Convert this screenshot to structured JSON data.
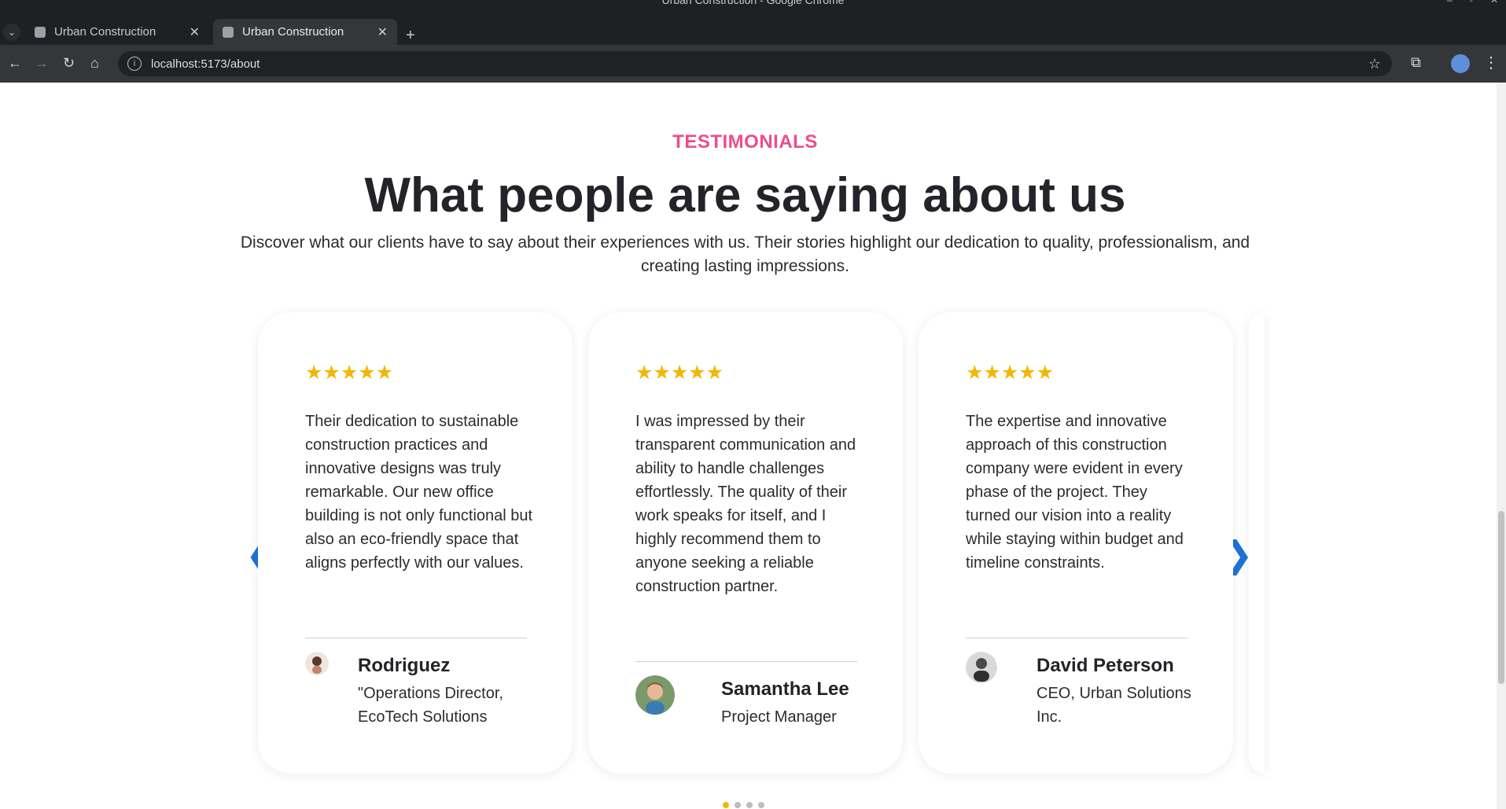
{
  "browser": {
    "window_title": "Urban Construction - Google Chrome",
    "tabs": [
      {
        "label": "Urban Construction"
      },
      {
        "label": "Urban Construction"
      }
    ],
    "url": "localhost:5173/about"
  },
  "section": {
    "eyebrow": "TESTIMONIALS",
    "headline": "What people are saying about us",
    "subtitle": "Discover what our clients have to say about their experiences with us. Their stories highlight our dedication to quality, professionalism, and creating lasting impressions."
  },
  "testimonials": [
    {
      "stars": "★★★★★",
      "quote": "Their dedication to sustainable construction practices and innovative designs was truly remarkable. Our new office building is not only functional but also an eco-friendly space that aligns perfectly with our values.",
      "name": "Rodriguez",
      "role": "\"Operations Director, EcoTech Solutions"
    },
    {
      "stars": "★★★★★",
      "quote": "I was impressed by their transparent communication and ability to handle challenges effortlessly. The quality of their work speaks for itself, and I highly recommend them to anyone seeking a reliable construction partner.",
      "name": "Samantha Lee",
      "role": "Project Manager"
    },
    {
      "stars": "★★★★★",
      "quote": "The expertise and innovative approach of this construction company were evident in every phase of the project. They turned our vision into a reality while staying within budget and timeline constraints.",
      "name": "David Peterson",
      "role": "CEO, Urban Solutions Inc."
    }
  ],
  "carousel": {
    "active_index": 0,
    "dot_count": 4
  },
  "colors": {
    "accent_pink": "#ec4d8e",
    "star_gold": "#f2b705",
    "arrow_blue": "#1e73d8"
  }
}
